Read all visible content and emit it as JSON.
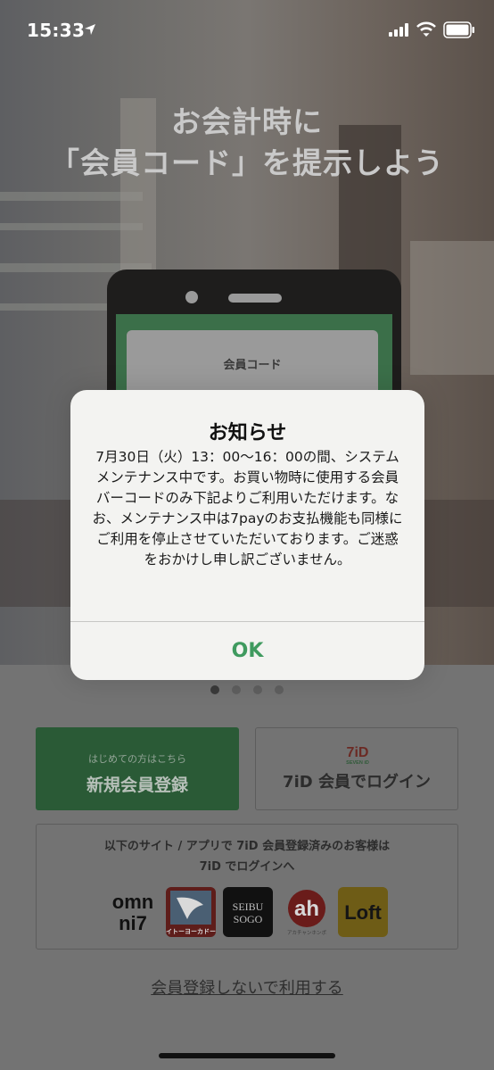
{
  "status_bar": {
    "time": "15:33",
    "icons": [
      "location-arrow-icon",
      "signal-icon",
      "wifi-icon",
      "battery-icon"
    ]
  },
  "hero": {
    "headline_line1": "お会計時に",
    "headline_line2": "「会員コード」を提示しよう",
    "phone_card_title": "会員コード"
  },
  "alert": {
    "title": "お知らせ",
    "message": "7月30日（火）13：00〜16：00の間、システムメンテナンス中です。お買い物時に使用する会員バーコードのみ下記よりご利用いただけます。なお、メンテナンス中は7payのお支払機能も同様にご利用を停止させていただいております。ご迷惑をおかけし申し訳ございません。",
    "ok_label": "OK",
    "ok_color": "#3f9a5f"
  },
  "pager": {
    "count": 4,
    "active_index": 0
  },
  "register_button": {
    "sub_label": "はじめての方はこちら",
    "label": "新規会員登録",
    "color": "#2a5a36"
  },
  "login_button": {
    "logo_text": "7iD",
    "logo_subtext": "SEVEN iD",
    "label": "7iD 会員でログイン"
  },
  "partners": {
    "line1": "以下のサイト / アプリで 7iD 会員登録済みのお客様は",
    "line2": "7iD でログインへ",
    "logos": [
      {
        "name": "omni7",
        "line1": "omn",
        "line2": "ni7"
      },
      {
        "name": "ito-yokado",
        "text": "イトーヨーカドー"
      },
      {
        "name": "seibu-sogo",
        "line1": "SEIBU",
        "line2": "SOGO"
      },
      {
        "name": "akachan-honpo",
        "text": "ah",
        "subtext": "アカチャンホンポ"
      },
      {
        "name": "loft",
        "text": "Loft"
      }
    ]
  },
  "skip_link": "会員登録しないで利用する"
}
